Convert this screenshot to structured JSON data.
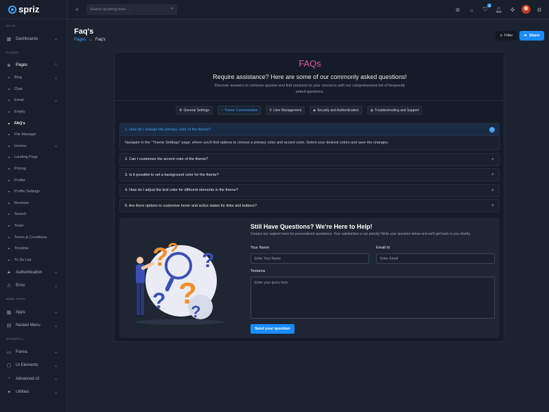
{
  "brand": {
    "name": "spriz"
  },
  "sidebar": {
    "sections": {
      "main": "MAIN",
      "pages": "PAGES",
      "web_apps": "WEB APPS",
      "general": "GENERAL"
    },
    "dashboards": "Dashboards",
    "pages": "Pages",
    "sub_items": [
      {
        "label": "Blog",
        "chevron": true
      },
      {
        "label": "Chat",
        "chevron": false
      },
      {
        "label": "Email",
        "chevron": true
      },
      {
        "label": "Empty",
        "chevron": false
      },
      {
        "label": "FAQ's",
        "chevron": false,
        "active": true
      },
      {
        "label": "File Manager",
        "chevron": false
      },
      {
        "label": "Invoice",
        "chevron": true
      },
      {
        "label": "Landing Page",
        "chevron": false
      },
      {
        "label": "Pricing",
        "chevron": false
      },
      {
        "label": "Profile",
        "chevron": false
      },
      {
        "label": "Profile Settings",
        "chevron": false
      },
      {
        "label": "Reviews",
        "chevron": false
      },
      {
        "label": "Search",
        "chevron": false
      },
      {
        "label": "Team",
        "chevron": false
      },
      {
        "label": "Terms & Conditions",
        "chevron": false
      },
      {
        "label": "Timeline",
        "chevron": false
      },
      {
        "label": "To Do List",
        "chevron": false
      }
    ],
    "authentication": "Authentication",
    "error": "Error",
    "apps": "Apps",
    "nested_menu": "Nested Menu",
    "forms": "Forms",
    "ui_elements": "UI Elements",
    "advanced_ui": "Advanced UI",
    "utilities": "Utilities"
  },
  "header": {
    "search_placeholder": "Search anything here ...",
    "cart_count": "5"
  },
  "page": {
    "title": "Faq's",
    "breadcrumb_parent": "Pages",
    "breadcrumb_sep": "↔",
    "breadcrumb_current": "Faq's",
    "filter_label": "Filter",
    "share_label": "Share"
  },
  "faq": {
    "title": "FAQs",
    "heading": "Require assistance? Here are some of our commonly asked questions!",
    "subheading": "Discover answers to common queries and find solutions to your concerns with our comprehensive list of frequently asked questions.",
    "tabs": [
      {
        "label": "General Settings",
        "icon": "⚙",
        "active": false
      },
      {
        "label": "Theme Customization",
        "icon": "◔",
        "active": true
      },
      {
        "label": "User Management",
        "icon": "⚲",
        "active": false
      },
      {
        "label": "Security and Authentication",
        "icon": "◈",
        "active": false
      },
      {
        "label": "Troubleshooting and Support",
        "icon": "◍",
        "active": false
      }
    ],
    "open_question": "1. How do I change the primary color of the theme?",
    "open_answer": "Navigate to the \"Theme Settings\" page, where you'll find options to choose a primary color and accent color. Select your desired colors and save the changes.",
    "questions": [
      "2. Can I customize the accent color of the theme?",
      "3. Is it possible to set a background color for the theme?",
      "4. How do I adjust the text color for different elements in the theme?",
      "5. Are there options to customize hover and active states for links and buttons?"
    ]
  },
  "contact": {
    "title": "Still Have Questions? We're Here to Help!",
    "subtitle": "Contact our support team for personalized assistance. Your satisfaction is our priority! Write your question below and we'll get back to you shortly.",
    "name_label": "Your Name",
    "name_placeholder": "Enter Your Name",
    "email_label": "Email Id",
    "email_placeholder": "Enter Email",
    "text_label": "Textarea",
    "text_placeholder": "Enter your query here",
    "submit_label": "Send your question"
  },
  "colors": {
    "accent": "#1a8cff",
    "faq_title": "#e2589b",
    "background": "#1c2330"
  }
}
